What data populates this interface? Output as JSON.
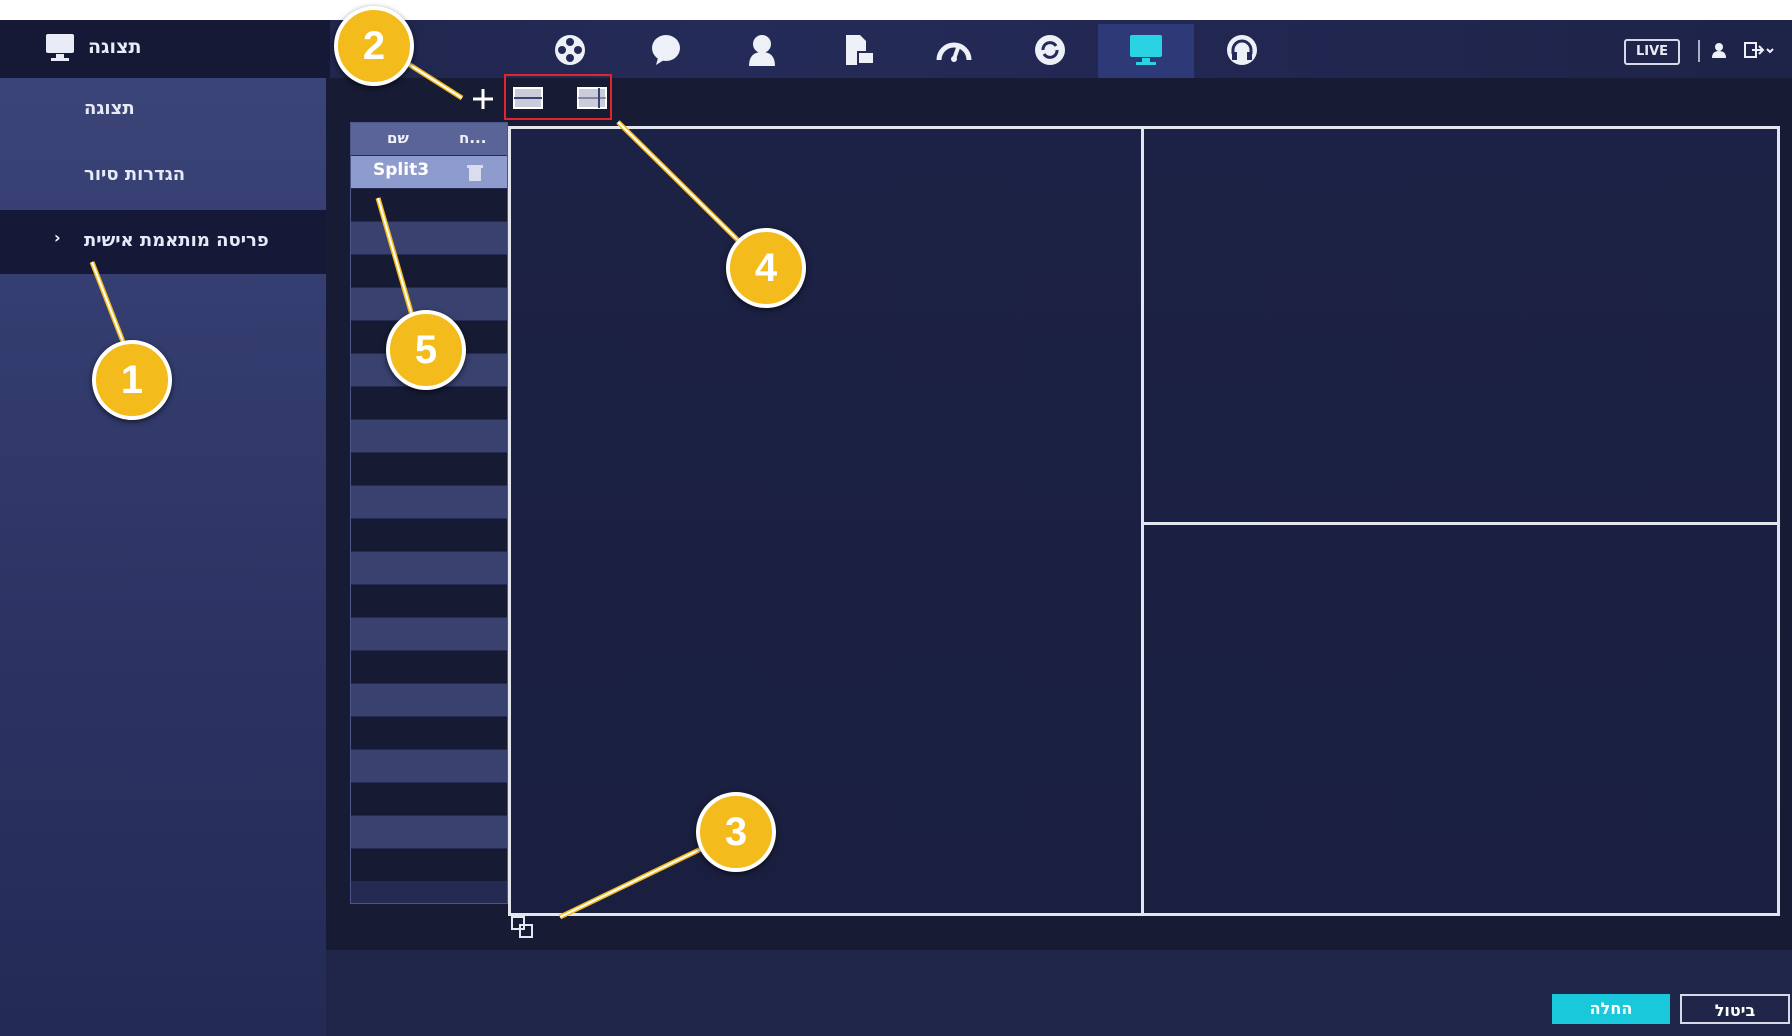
{
  "header": {
    "title": "תצוגה",
    "live_label": "LIVE",
    "nav_icons": [
      "film-reel-icon",
      "chat-bubble-icon",
      "user-icon",
      "storage-icon",
      "speedometer-icon",
      "refresh-icon",
      "monitor-icon",
      "headset-icon"
    ],
    "active_nav": "monitor-icon"
  },
  "sidebar": {
    "items": [
      {
        "label": "תצוגה",
        "active": false
      },
      {
        "label": "הגדרות סיור",
        "active": false
      },
      {
        "label": "פריסה מותאמת אישית",
        "active": true
      }
    ]
  },
  "split_list": {
    "columns": [
      "ח...",
      "שם"
    ],
    "rows": [
      {
        "name": "Split3"
      }
    ]
  },
  "buttons": {
    "apply": "החלה",
    "cancel": "ביטול"
  },
  "callouts": [
    "1",
    "2",
    "3",
    "4",
    "5"
  ],
  "colors": {
    "accent": "#19c8da",
    "callout": "#f4bb1c",
    "highlight_box": "#e0252c"
  }
}
